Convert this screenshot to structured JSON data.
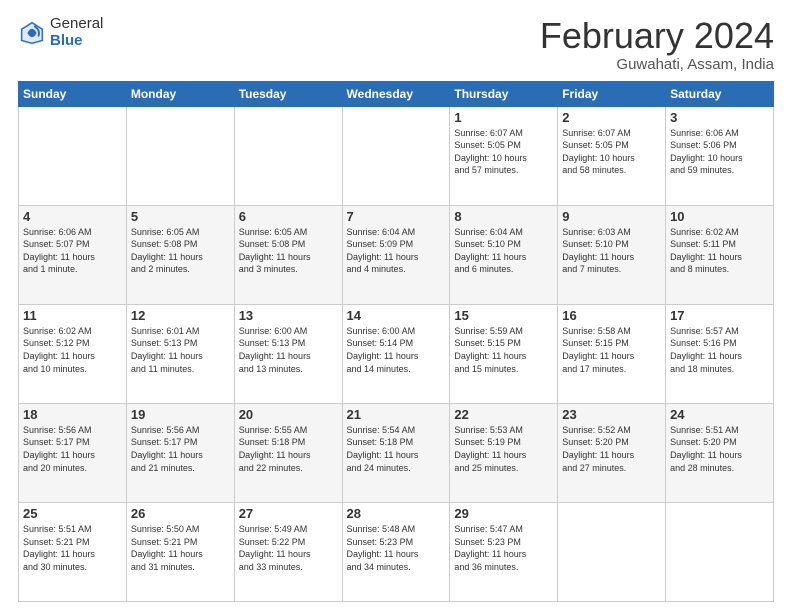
{
  "logo": {
    "general": "General",
    "blue": "Blue"
  },
  "title": "February 2024",
  "location": "Guwahati, Assam, India",
  "days_of_week": [
    "Sunday",
    "Monday",
    "Tuesday",
    "Wednesday",
    "Thursday",
    "Friday",
    "Saturday"
  ],
  "weeks": [
    [
      {
        "day": "",
        "info": ""
      },
      {
        "day": "",
        "info": ""
      },
      {
        "day": "",
        "info": ""
      },
      {
        "day": "",
        "info": ""
      },
      {
        "day": "1",
        "info": "Sunrise: 6:07 AM\nSunset: 5:05 PM\nDaylight: 10 hours\nand 57 minutes."
      },
      {
        "day": "2",
        "info": "Sunrise: 6:07 AM\nSunset: 5:05 PM\nDaylight: 10 hours\nand 58 minutes."
      },
      {
        "day": "3",
        "info": "Sunrise: 6:06 AM\nSunset: 5:06 PM\nDaylight: 10 hours\nand 59 minutes."
      }
    ],
    [
      {
        "day": "4",
        "info": "Sunrise: 6:06 AM\nSunset: 5:07 PM\nDaylight: 11 hours\nand 1 minute."
      },
      {
        "day": "5",
        "info": "Sunrise: 6:05 AM\nSunset: 5:08 PM\nDaylight: 11 hours\nand 2 minutes."
      },
      {
        "day": "6",
        "info": "Sunrise: 6:05 AM\nSunset: 5:08 PM\nDaylight: 11 hours\nand 3 minutes."
      },
      {
        "day": "7",
        "info": "Sunrise: 6:04 AM\nSunset: 5:09 PM\nDaylight: 11 hours\nand 4 minutes."
      },
      {
        "day": "8",
        "info": "Sunrise: 6:04 AM\nSunset: 5:10 PM\nDaylight: 11 hours\nand 6 minutes."
      },
      {
        "day": "9",
        "info": "Sunrise: 6:03 AM\nSunset: 5:10 PM\nDaylight: 11 hours\nand 7 minutes."
      },
      {
        "day": "10",
        "info": "Sunrise: 6:02 AM\nSunset: 5:11 PM\nDaylight: 11 hours\nand 8 minutes."
      }
    ],
    [
      {
        "day": "11",
        "info": "Sunrise: 6:02 AM\nSunset: 5:12 PM\nDaylight: 11 hours\nand 10 minutes."
      },
      {
        "day": "12",
        "info": "Sunrise: 6:01 AM\nSunset: 5:13 PM\nDaylight: 11 hours\nand 11 minutes."
      },
      {
        "day": "13",
        "info": "Sunrise: 6:00 AM\nSunset: 5:13 PM\nDaylight: 11 hours\nand 13 minutes."
      },
      {
        "day": "14",
        "info": "Sunrise: 6:00 AM\nSunset: 5:14 PM\nDaylight: 11 hours\nand 14 minutes."
      },
      {
        "day": "15",
        "info": "Sunrise: 5:59 AM\nSunset: 5:15 PM\nDaylight: 11 hours\nand 15 minutes."
      },
      {
        "day": "16",
        "info": "Sunrise: 5:58 AM\nSunset: 5:15 PM\nDaylight: 11 hours\nand 17 minutes."
      },
      {
        "day": "17",
        "info": "Sunrise: 5:57 AM\nSunset: 5:16 PM\nDaylight: 11 hours\nand 18 minutes."
      }
    ],
    [
      {
        "day": "18",
        "info": "Sunrise: 5:56 AM\nSunset: 5:17 PM\nDaylight: 11 hours\nand 20 minutes."
      },
      {
        "day": "19",
        "info": "Sunrise: 5:56 AM\nSunset: 5:17 PM\nDaylight: 11 hours\nand 21 minutes."
      },
      {
        "day": "20",
        "info": "Sunrise: 5:55 AM\nSunset: 5:18 PM\nDaylight: 11 hours\nand 22 minutes."
      },
      {
        "day": "21",
        "info": "Sunrise: 5:54 AM\nSunset: 5:18 PM\nDaylight: 11 hours\nand 24 minutes."
      },
      {
        "day": "22",
        "info": "Sunrise: 5:53 AM\nSunset: 5:19 PM\nDaylight: 11 hours\nand 25 minutes."
      },
      {
        "day": "23",
        "info": "Sunrise: 5:52 AM\nSunset: 5:20 PM\nDaylight: 11 hours\nand 27 minutes."
      },
      {
        "day": "24",
        "info": "Sunrise: 5:51 AM\nSunset: 5:20 PM\nDaylight: 11 hours\nand 28 minutes."
      }
    ],
    [
      {
        "day": "25",
        "info": "Sunrise: 5:51 AM\nSunset: 5:21 PM\nDaylight: 11 hours\nand 30 minutes."
      },
      {
        "day": "26",
        "info": "Sunrise: 5:50 AM\nSunset: 5:21 PM\nDaylight: 11 hours\nand 31 minutes."
      },
      {
        "day": "27",
        "info": "Sunrise: 5:49 AM\nSunset: 5:22 PM\nDaylight: 11 hours\nand 33 minutes."
      },
      {
        "day": "28",
        "info": "Sunrise: 5:48 AM\nSunset: 5:23 PM\nDaylight: 11 hours\nand 34 minutes."
      },
      {
        "day": "29",
        "info": "Sunrise: 5:47 AM\nSunset: 5:23 PM\nDaylight: 11 hours\nand 36 minutes."
      },
      {
        "day": "",
        "info": ""
      },
      {
        "day": "",
        "info": ""
      }
    ]
  ]
}
